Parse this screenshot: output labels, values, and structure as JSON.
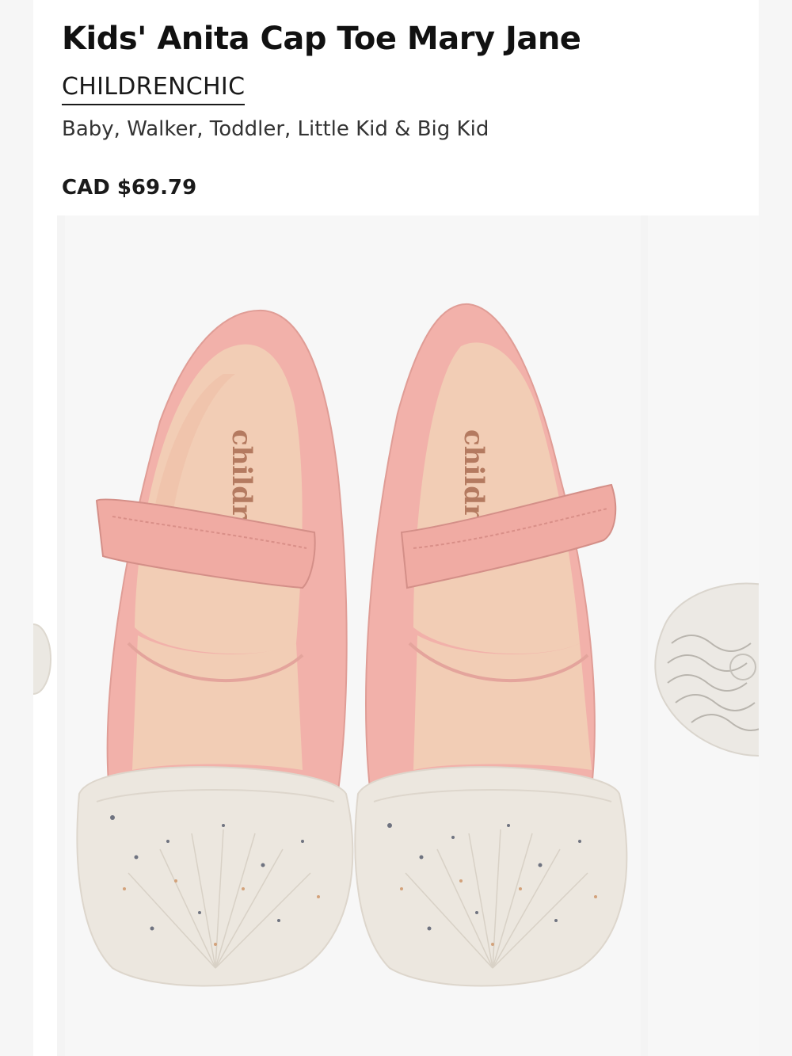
{
  "product": {
    "title": "Kids' Anita Cap Toe Mary Jane",
    "brand": "CHILDRENCHIC",
    "sizes": "Baby, Walker, Toddler, Little Kid & Big Kid",
    "price": "CAD $69.79"
  },
  "image": {
    "insole_logo_left": "childrenc",
    "insole_logo_right": "childrenc",
    "colors": {
      "canvas_pink": "#f2b1aa",
      "insole": "#f2cdb5",
      "toe_cap": "#ece7df",
      "background": "#f7f7f7"
    }
  }
}
